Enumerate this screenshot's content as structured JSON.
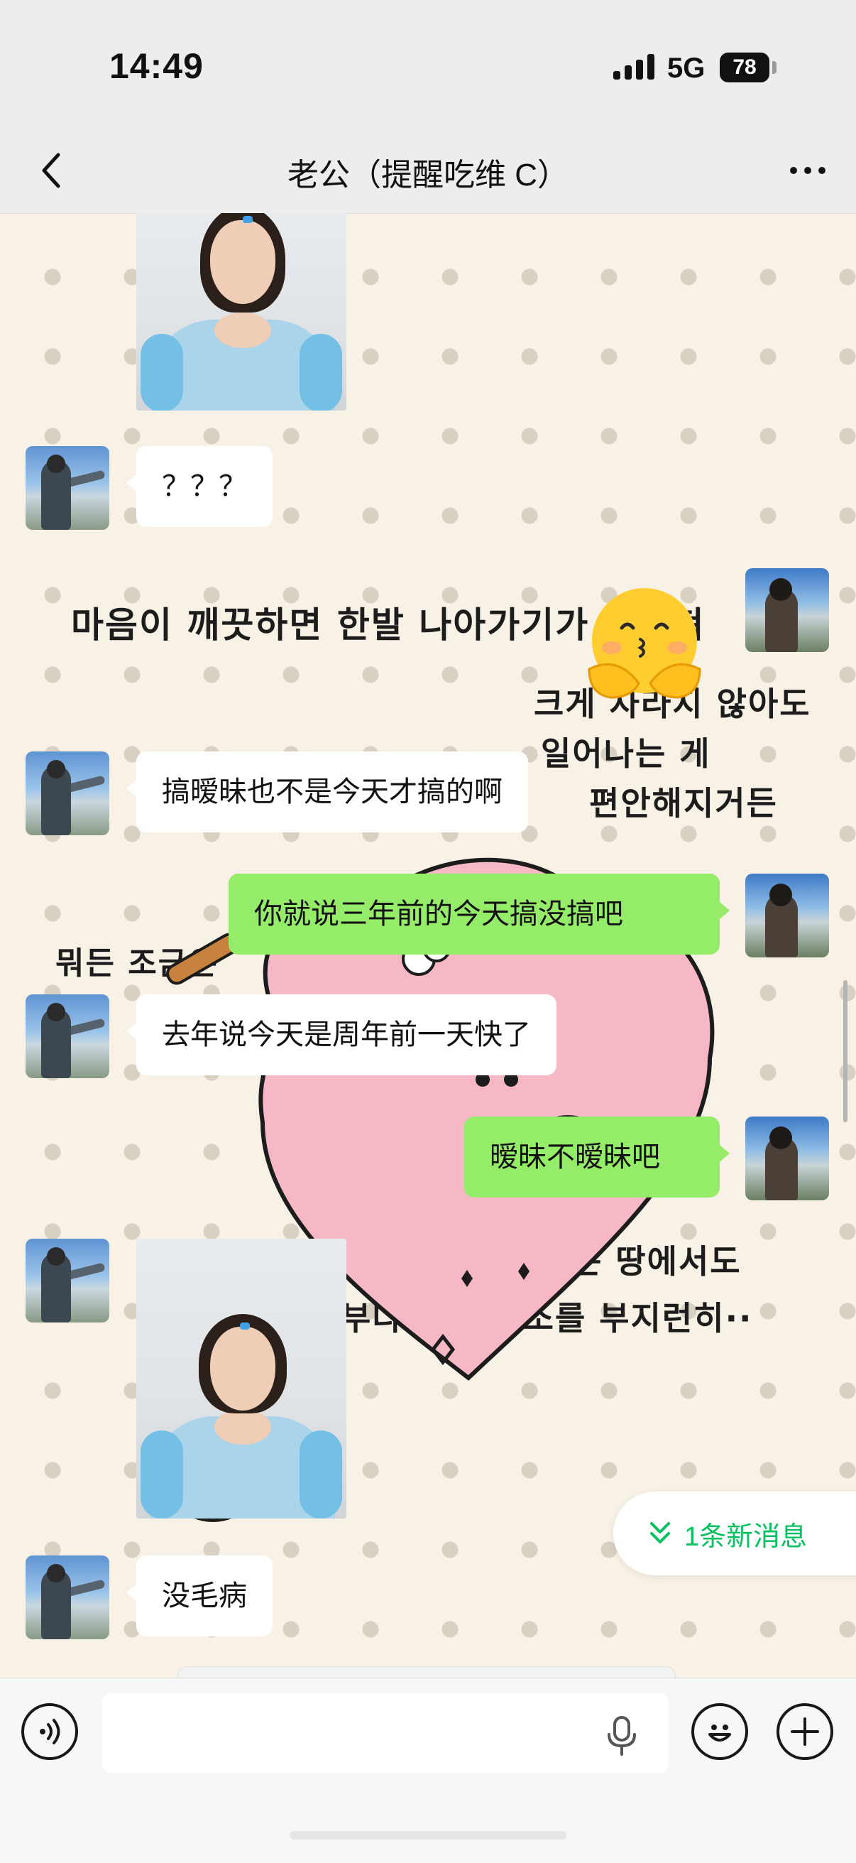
{
  "status_bar": {
    "time": "14:49",
    "network": "5G",
    "battery": "78"
  },
  "nav": {
    "title": "老公（提醒吃维 C）",
    "back_icon": "chevron-left-icon",
    "more_icon": "more-dots-icon"
  },
  "wallpaper": {
    "lines": [
      "마음이 깨끗하면 한발 나아가기가 쉬워져",
      "크게 자라지 않아도",
      "일어나는 게",
      "편안해지거든",
      "뭐든 조금은",
      "루고 싶은 게 있는 땅에서도",
      "부다 마음 청소를 부지런히··"
    ]
  },
  "messages": [
    {
      "kind": "image",
      "from": "partner",
      "alt": "photo"
    },
    {
      "kind": "text",
      "from": "partner",
      "text": "？？？"
    },
    {
      "kind": "sticker",
      "from": "me",
      "emoji": "🫣"
    },
    {
      "kind": "text",
      "from": "partner",
      "text": "搞暧昧也不是今天才搞的啊"
    },
    {
      "kind": "text",
      "from": "me",
      "text": "你就说三年前的今天搞没搞吧"
    },
    {
      "kind": "text",
      "from": "partner",
      "text": "去年说今天是周年前一天快了"
    },
    {
      "kind": "text",
      "from": "me",
      "text": "暧昧不暧昧吧"
    },
    {
      "kind": "image",
      "from": "partner",
      "alt": "photo"
    },
    {
      "kind": "text",
      "from": "partner",
      "text": "没毛病"
    }
  ],
  "new_messages": {
    "label": "1条新消息"
  },
  "input_bar": {
    "placeholder": "",
    "voice_icon": "voice-icon",
    "mic_icon": "mic-icon",
    "emoji_icon": "emoji-icon",
    "plus_icon": "plus-icon"
  },
  "colors": {
    "outgoing_bubble": "#95ec69",
    "incoming_bubble": "#ffffff",
    "accent": "#07c160"
  }
}
